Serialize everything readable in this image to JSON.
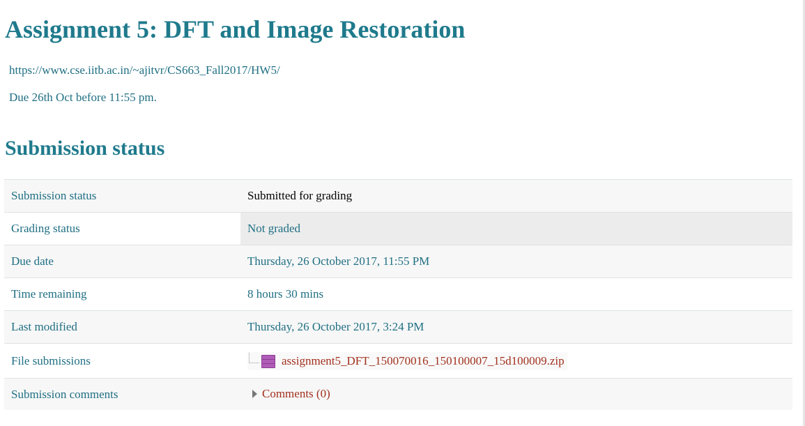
{
  "assignment": {
    "title": "Assignment 5: DFT and Image Restoration",
    "url_text": "https://www.cse.iitb.ac.in/~ajitvr/CS663_Fall2017/HW5/",
    "due_text": "Due 26th Oct before 11:55 pm."
  },
  "section": {
    "title": "Submission status"
  },
  "rows": {
    "submission_status": {
      "label": "Submission status",
      "value": "Submitted for grading"
    },
    "grading_status": {
      "label": "Grading status",
      "value": "Not graded"
    },
    "due_date": {
      "label": "Due date",
      "value": "Thursday, 26 October 2017, 11:55 PM"
    },
    "time_remaining": {
      "label": "Time remaining",
      "value": "8 hours 30 mins"
    },
    "last_modified": {
      "label": "Last modified",
      "value": "Thursday, 26 October 2017, 3:24 PM"
    },
    "file_submissions": {
      "label": "File submissions",
      "file_name": "assignment5_DFT_150070016_150100007_15d100009.zip",
      "icon": "archive-icon"
    },
    "submission_comments": {
      "label": "Submission comments",
      "link": "Comments (0)",
      "icon": "expand-triangle-icon"
    }
  },
  "colors": {
    "heading": "#1f7a8c",
    "text_link": "#1f6f83",
    "file_link": "#a1301d",
    "row_stripe": "#f7f7f7",
    "highlight_cell": "#ececec"
  }
}
